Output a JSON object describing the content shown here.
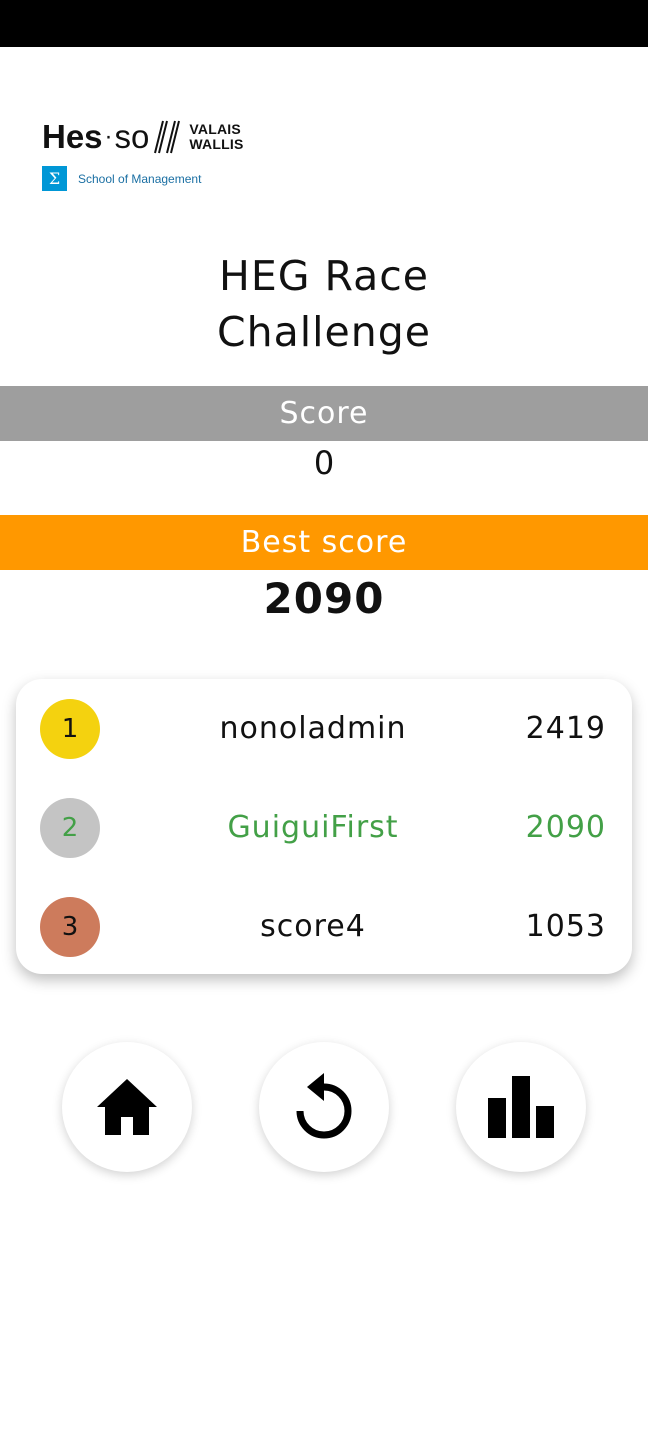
{
  "logo": {
    "hes": "Hes",
    "dot": "·",
    "so": "SO",
    "region_line1": "VALAIS",
    "region_line2": "WALLIS",
    "sigma": "Σ",
    "school": "School of Management"
  },
  "title": {
    "line1": "HEG Race",
    "line2": "Challenge"
  },
  "score": {
    "label": "Score",
    "value": "0"
  },
  "best_score": {
    "label": "Best score",
    "value": "2090"
  },
  "leaderboard": [
    {
      "rank": "1",
      "name": "nonoladmin",
      "score": "2419",
      "rank_color": "#f4d20f",
      "text_color": "#111111"
    },
    {
      "rank": "2",
      "name": "GuiguiFirst",
      "score": "2090",
      "rank_color": "#c4c4c4",
      "text_color": "#43a047"
    },
    {
      "rank": "3",
      "name": "score4",
      "score": "1053",
      "rank_color": "#cd7b5c",
      "text_color": "#111111"
    }
  ],
  "actions": [
    {
      "icon": "home-icon"
    },
    {
      "icon": "replay-icon"
    },
    {
      "icon": "leaderboard-icon"
    }
  ],
  "colors": {
    "score_band": "#9e9e9e",
    "best_band": "#ff9800",
    "highlight": "#43a047"
  }
}
